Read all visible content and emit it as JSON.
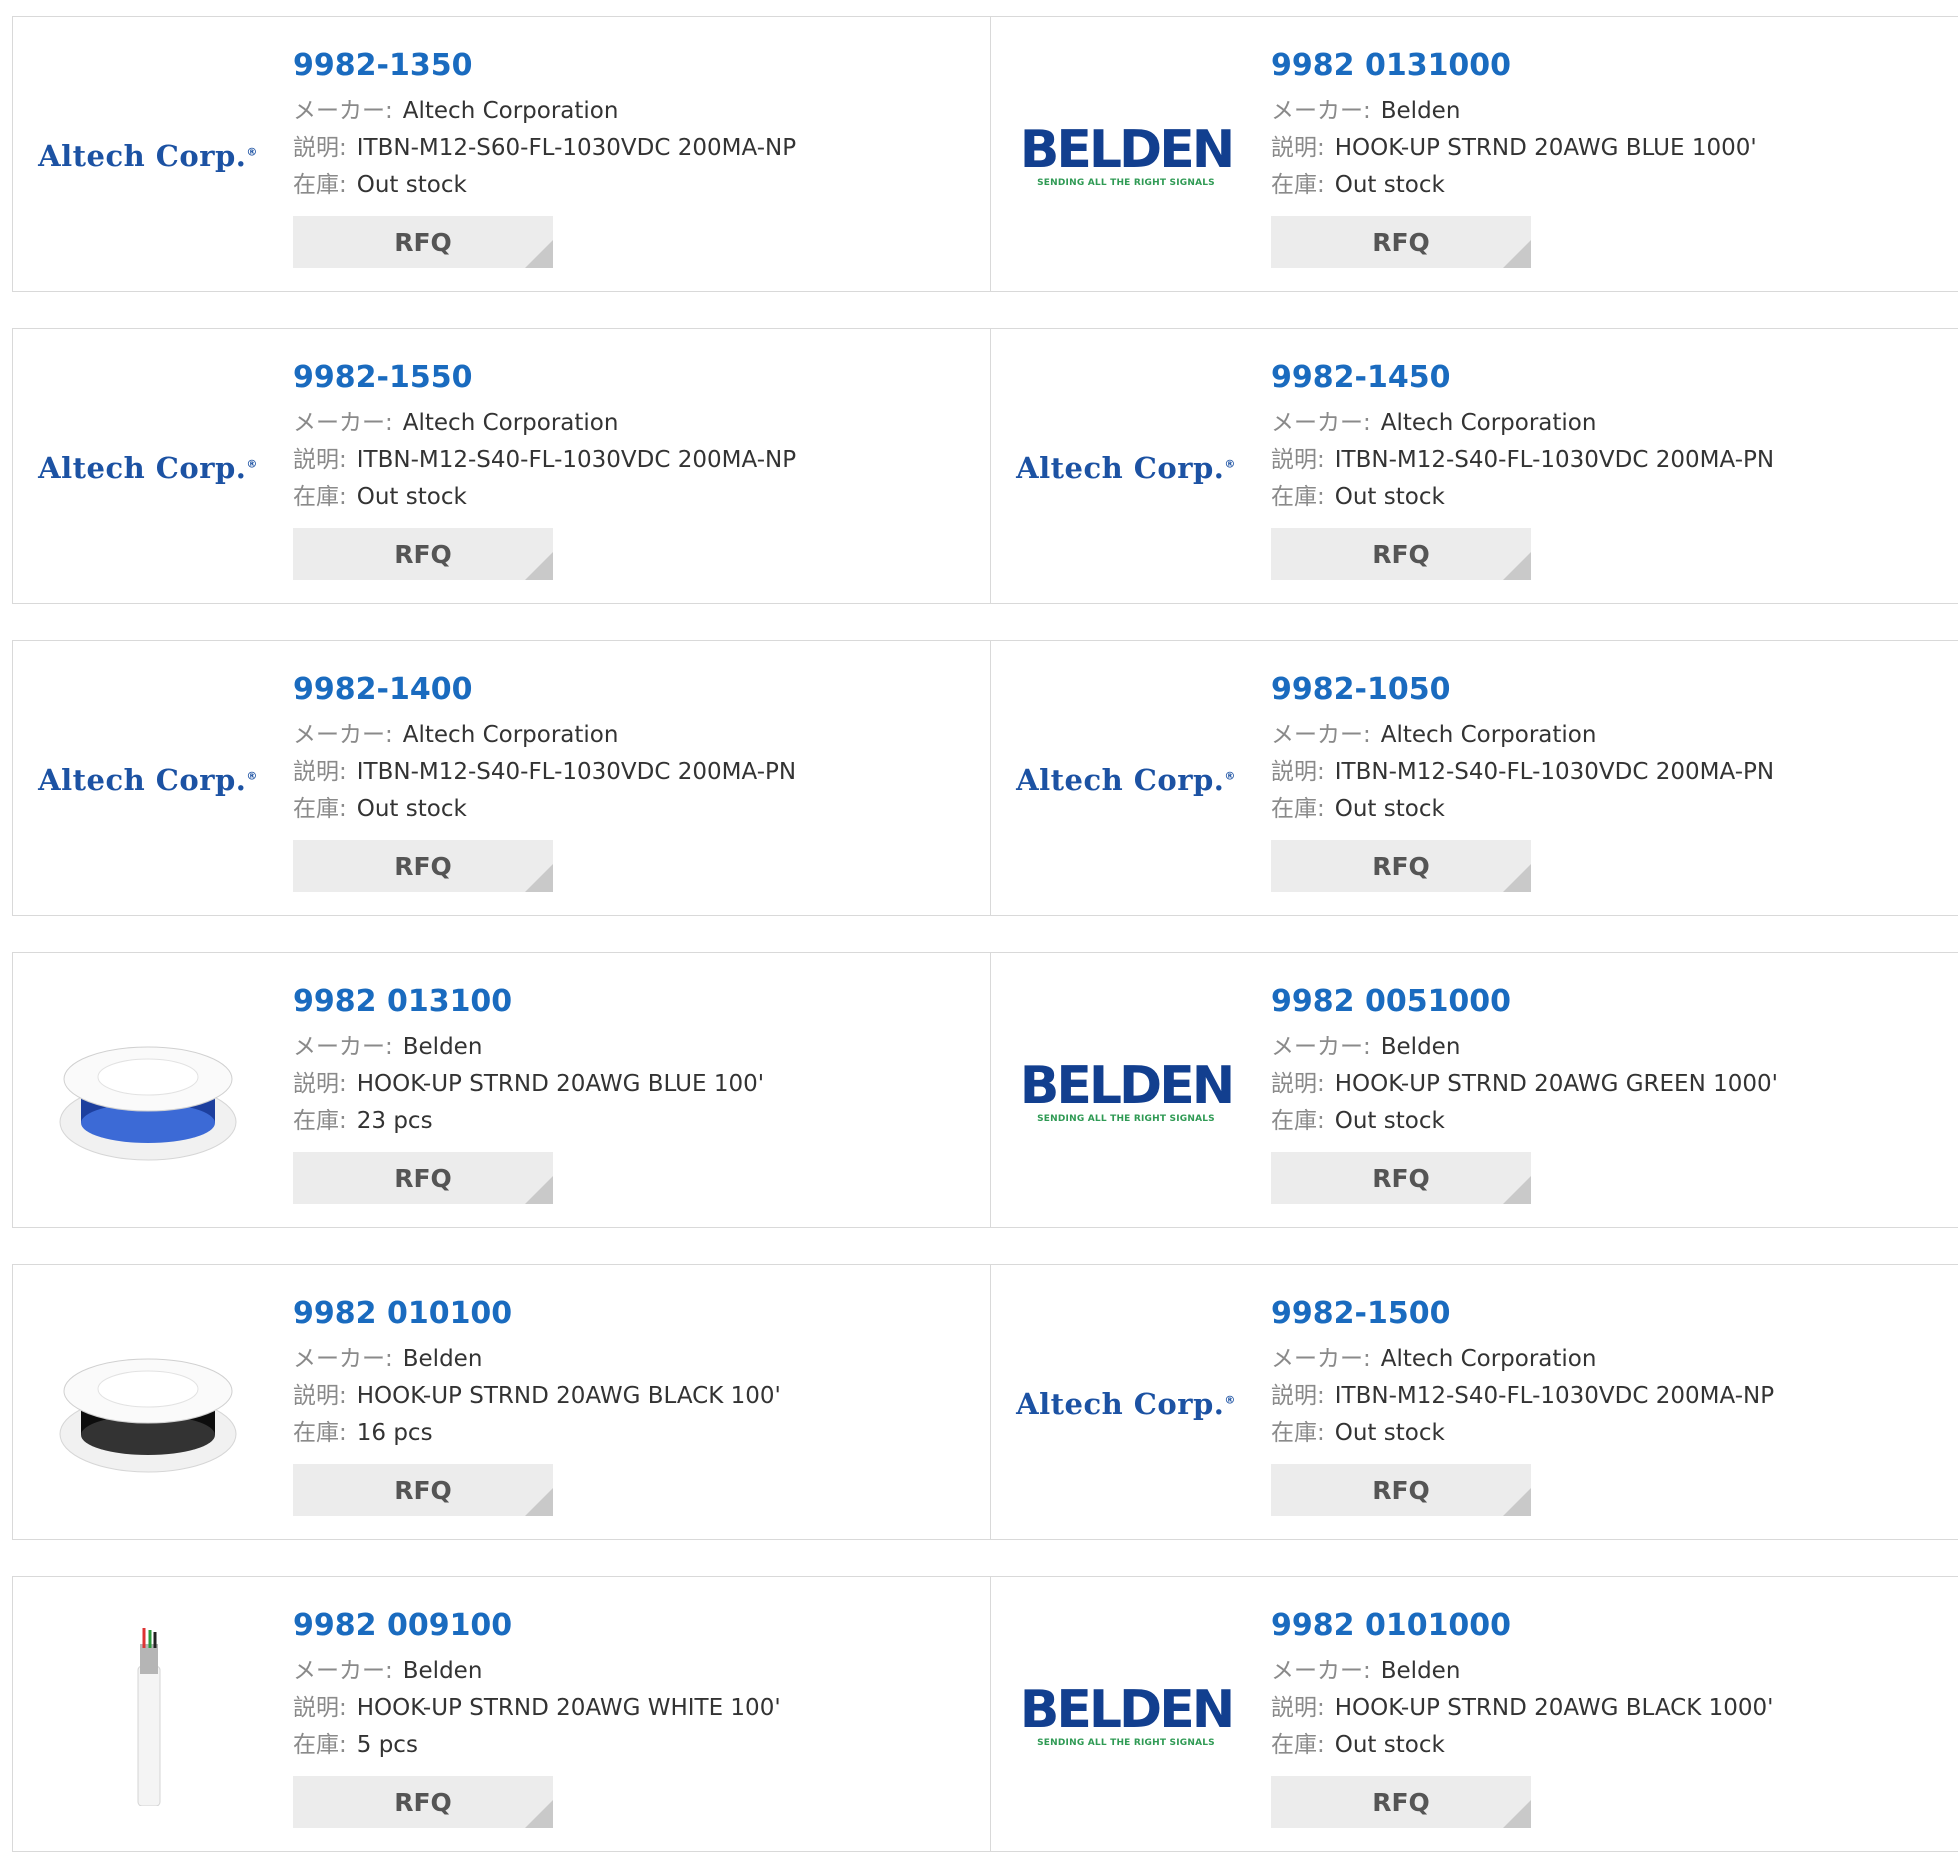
{
  "labels": {
    "maker": "メーカー:",
    "description": "説明:",
    "stock": "在庫:",
    "rfq": "RFQ"
  },
  "logos": {
    "altech": {
      "text": "Altech Corp.",
      "mark": "®"
    },
    "belden": {
      "text": "BELDEN",
      "tagline": "SENDING ALL THE RIGHT SIGNALS"
    }
  },
  "products": [
    {
      "part": "9982-1350",
      "maker": "Altech Corporation",
      "desc": "ITBN-M12-S60-FL-1030VDC 200MA-NP",
      "stock": "Out stock",
      "image": "altech-logo"
    },
    {
      "part": "9982 0131000",
      "maker": "Belden",
      "desc": "HOOK-UP STRND 20AWG BLUE 1000'",
      "stock": "Out stock",
      "image": "belden-logo"
    },
    {
      "part": "9982-1550",
      "maker": "Altech Corporation",
      "desc": "ITBN-M12-S40-FL-1030VDC 200MA-NP",
      "stock": "Out stock",
      "image": "altech-logo"
    },
    {
      "part": "9982-1450",
      "maker": "Altech Corporation",
      "desc": "ITBN-M12-S40-FL-1030VDC 200MA-PN",
      "stock": "Out stock",
      "image": "altech-logo"
    },
    {
      "part": "9982-1400",
      "maker": "Altech Corporation",
      "desc": "ITBN-M12-S40-FL-1030VDC 200MA-PN",
      "stock": "Out stock",
      "image": "altech-logo"
    },
    {
      "part": "9982-1050",
      "maker": "Altech Corporation",
      "desc": "ITBN-M12-S40-FL-1030VDC 200MA-PN",
      "stock": "Out stock",
      "image": "altech-logo"
    },
    {
      "part": "9982 013100",
      "maker": "Belden",
      "desc": "HOOK-UP STRND 20AWG BLUE 100'",
      "stock": "23 pcs",
      "image": "blue-wire-spool"
    },
    {
      "part": "9982 0051000",
      "maker": "Belden",
      "desc": "HOOK-UP STRND 20AWG GREEN 1000'",
      "stock": "Out stock",
      "image": "belden-logo"
    },
    {
      "part": "9982 010100",
      "maker": "Belden",
      "desc": "HOOK-UP STRND 20AWG BLACK 100'",
      "stock": "16 pcs",
      "image": "black-wire-spool"
    },
    {
      "part": "9982-1500",
      "maker": "Altech Corporation",
      "desc": "ITBN-M12-S40-FL-1030VDC 200MA-NP",
      "stock": "Out stock",
      "image": "altech-logo"
    },
    {
      "part": "9982 009100",
      "maker": "Belden",
      "desc": "HOOK-UP STRND 20AWG WHITE 100'",
      "stock": "5 pcs",
      "image": "white-cable"
    },
    {
      "part": "9982 0101000",
      "maker": "Belden",
      "desc": "HOOK-UP STRND 20AWG BLACK 1000'",
      "stock": "Out stock",
      "image": "belden-logo"
    }
  ]
}
